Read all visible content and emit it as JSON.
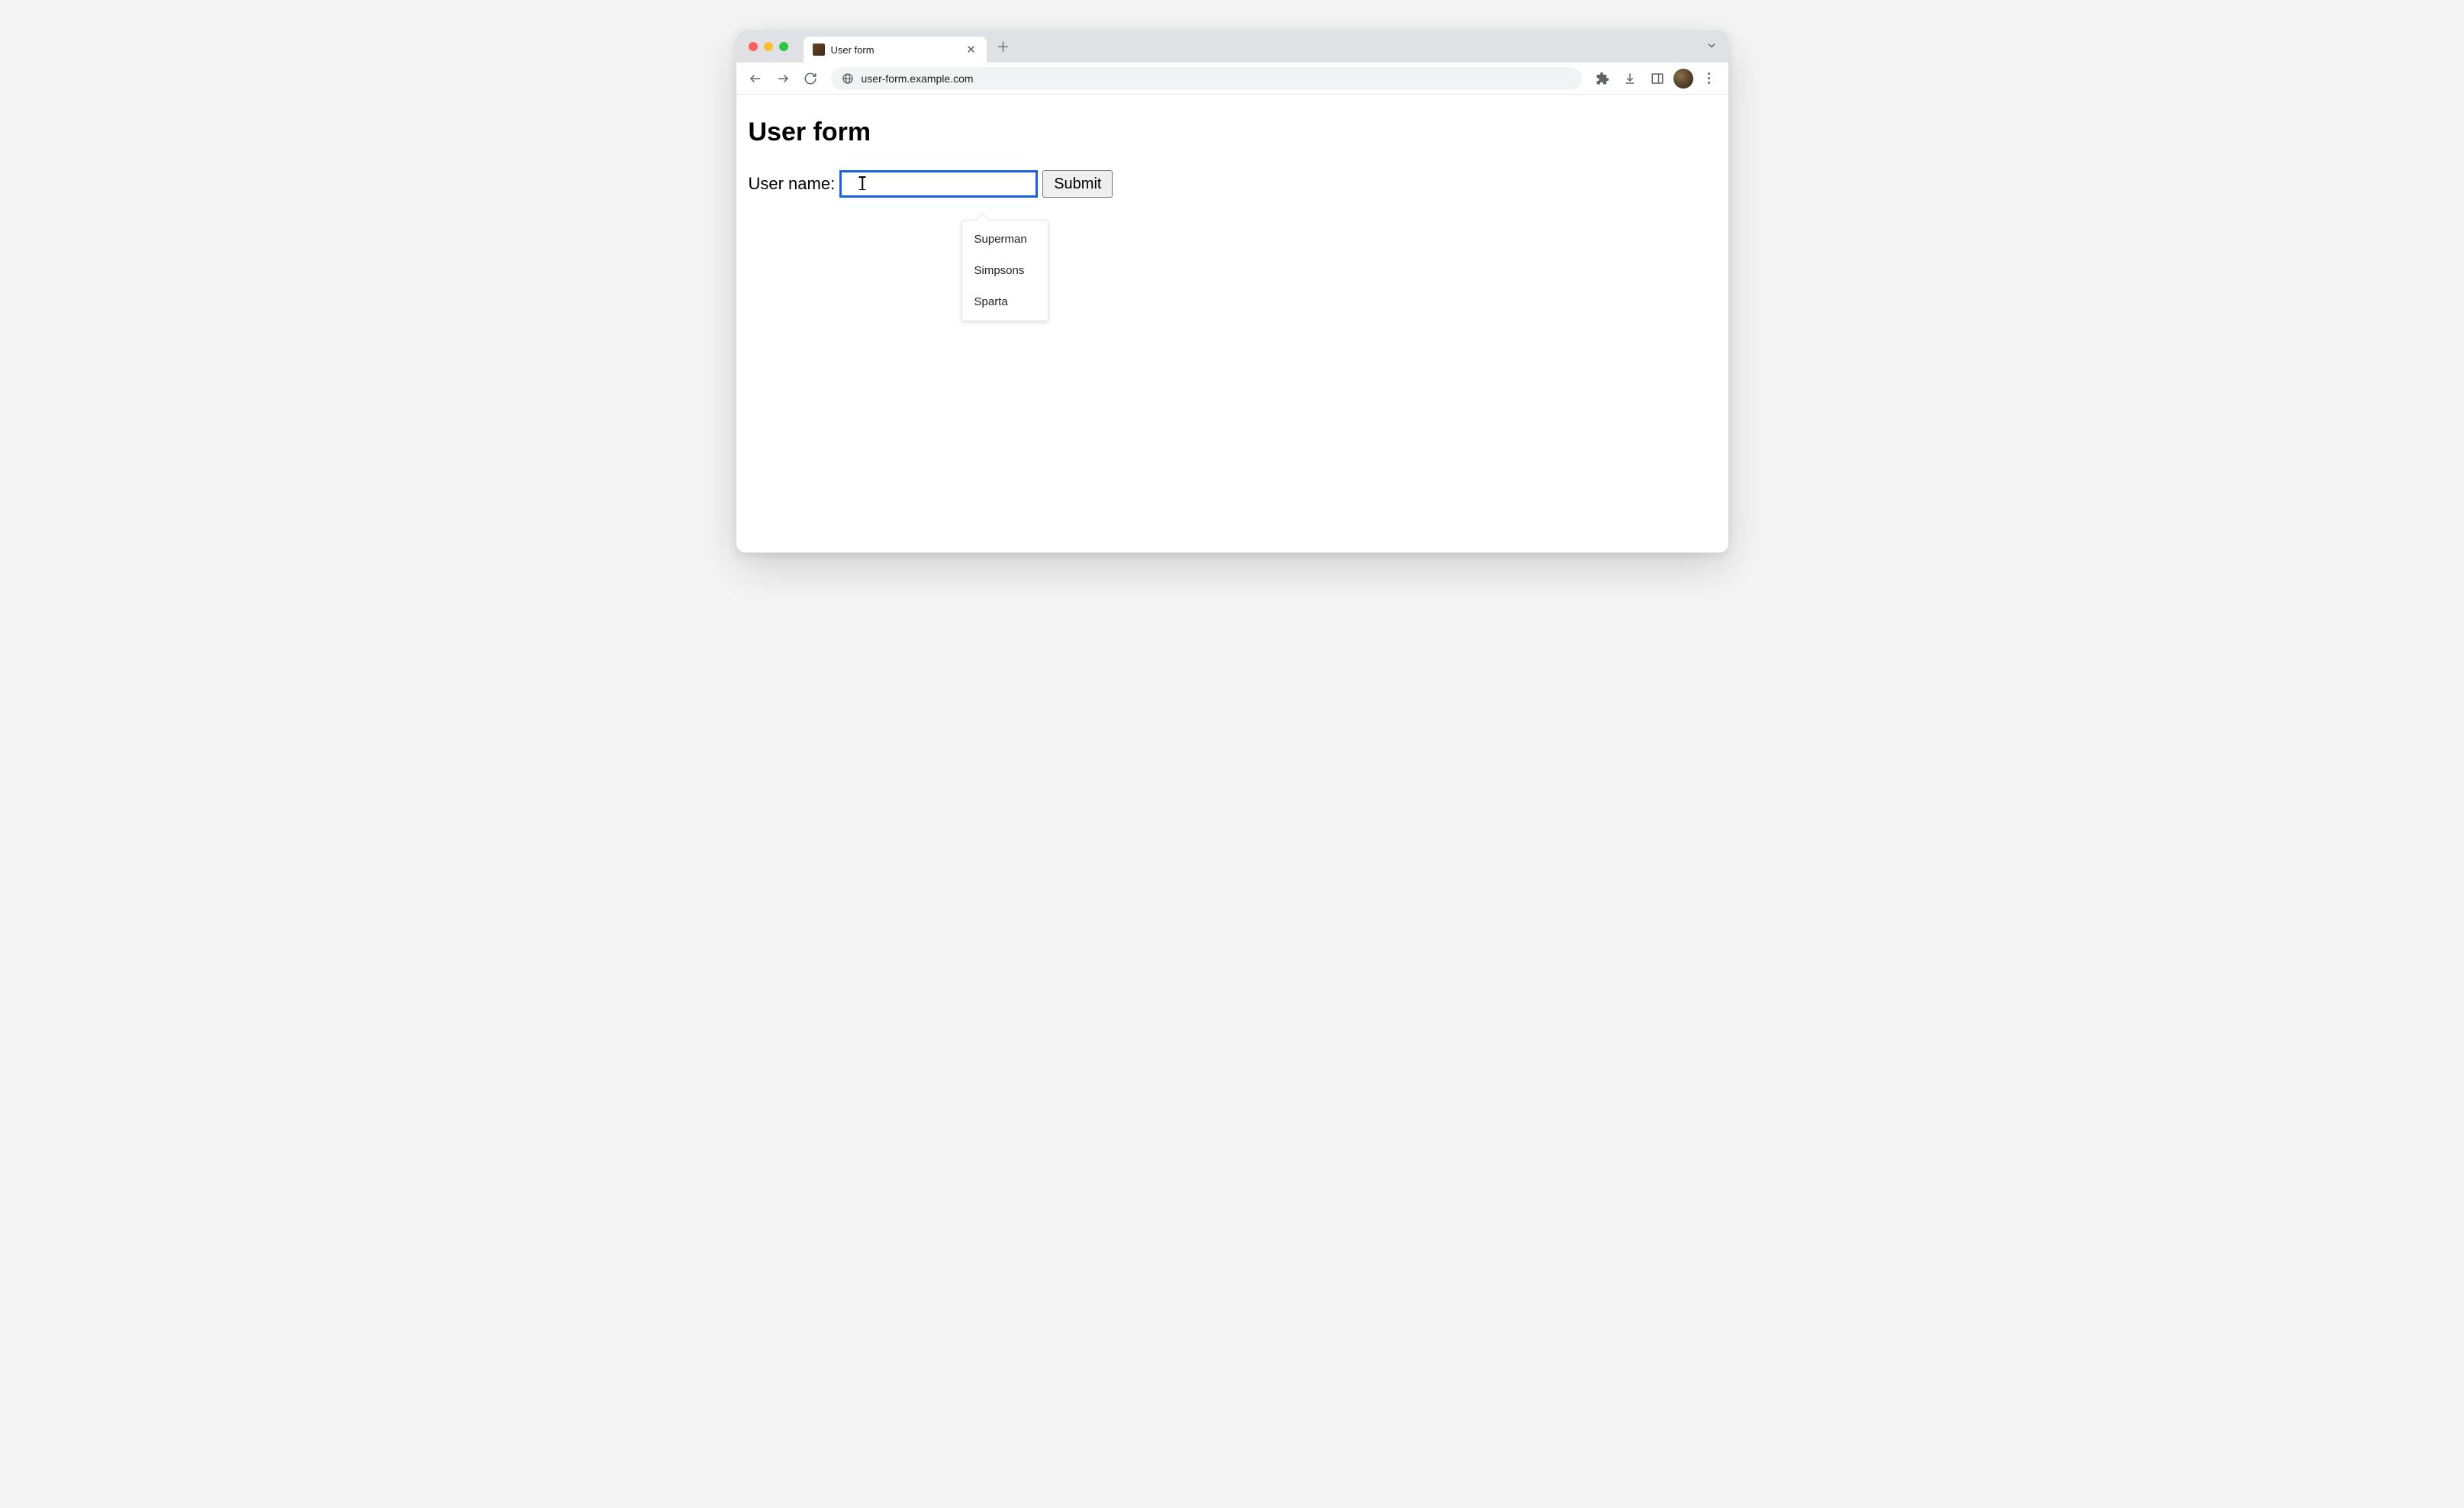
{
  "browser": {
    "tab_title": "User form",
    "url": "user-form.example.com"
  },
  "page": {
    "heading": "User form",
    "label": "User name:",
    "input_value": "",
    "submit_label": "Submit",
    "suggestions": {
      "0": "Superman",
      "1": "Simpsons",
      "2": "Sparta"
    }
  }
}
